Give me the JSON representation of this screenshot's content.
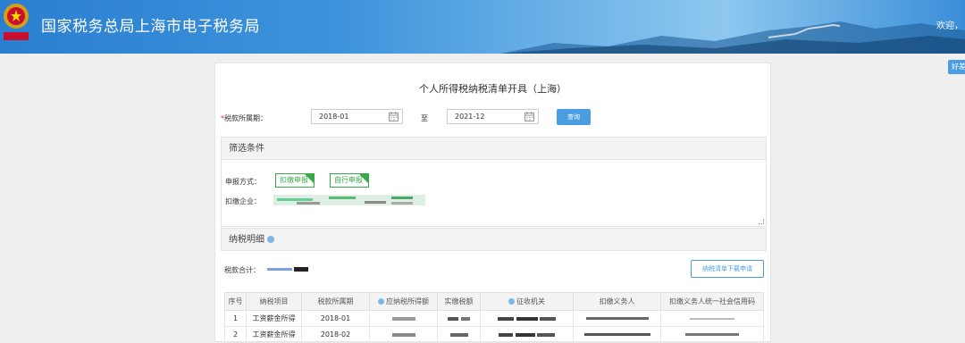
{
  "header": {
    "site_title": "国家税务总局上海市电子税务局",
    "welcome": "欢迎，"
  },
  "side_button": "好差",
  "form": {
    "title": "个人所得税纳税清单开具（上海）",
    "required_mark": "*",
    "period_label": "税款所属期：",
    "start_date": "2018-01",
    "to_label": "至",
    "end_date": "2021-12",
    "query_button": "查询"
  },
  "filter": {
    "heading": "筛选条件",
    "declare_mode_label": "申报方式：",
    "tags": [
      "扣缴申报",
      "自行申报"
    ],
    "withholder_label": "扣缴企业："
  },
  "detail": {
    "heading": "纳税明细",
    "total_label": "税款合计：",
    "download_button": "纳税清单下载申请",
    "columns": [
      "序号",
      "纳税项目",
      "税款所属期",
      "应纳税所得额",
      "实缴税额",
      "征收机关",
      "扣缴义务人",
      "扣缴义务人统一社会信用码"
    ],
    "rows": [
      {
        "index": "1",
        "item": "工资薪金所得",
        "period": "2018-01"
      },
      {
        "index": "2",
        "item": "工资薪金所得",
        "period": "2018-02"
      }
    ]
  },
  "colors": {
    "brand_blue": "#4a9de2",
    "tag_green": "#39a84a",
    "required_red": "#e23"
  }
}
